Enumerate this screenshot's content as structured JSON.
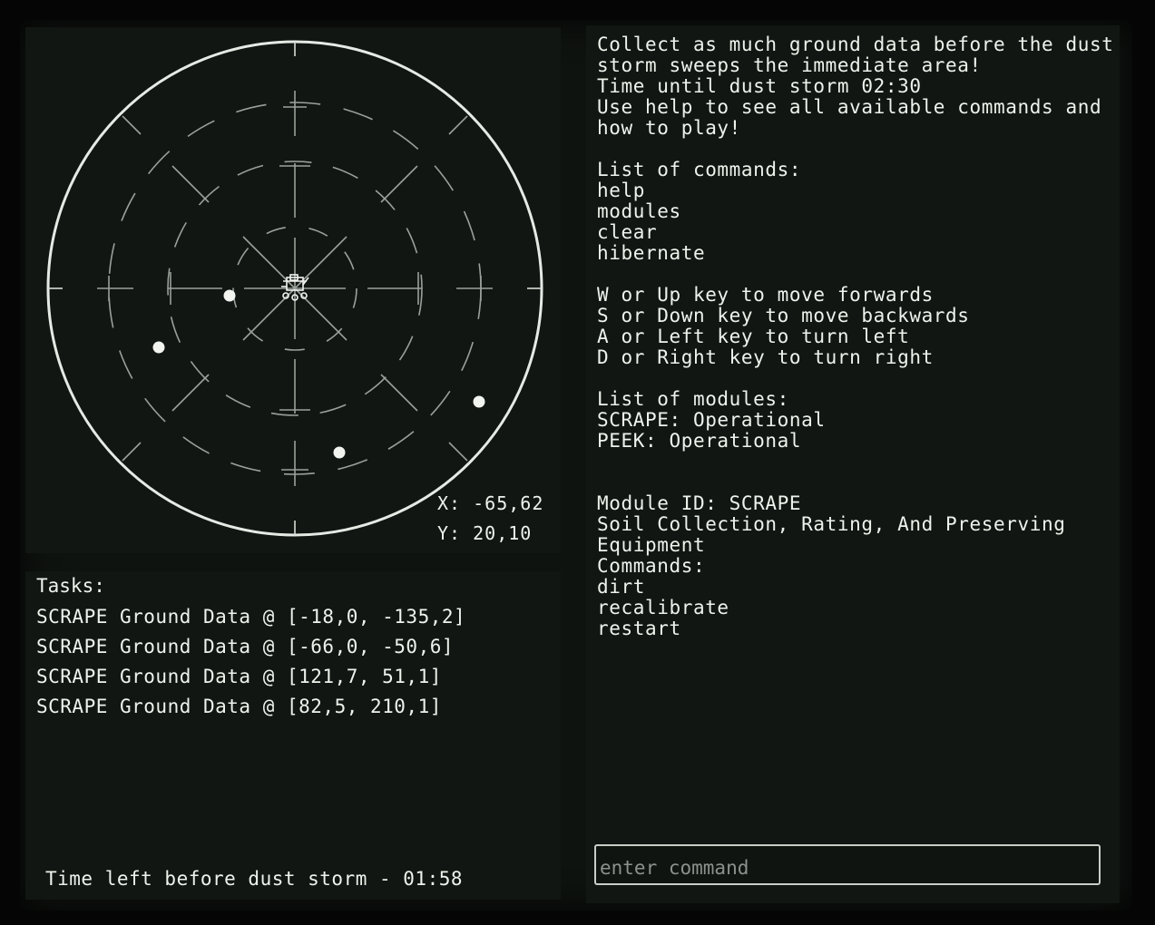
{
  "radar": {
    "coord_x": "X: -65,62",
    "coord_y": "Y: 20,10",
    "targets": [
      {
        "id": "target-1"
      },
      {
        "id": "target-2"
      },
      {
        "id": "target-3"
      },
      {
        "id": "target-4"
      }
    ]
  },
  "tasks": {
    "title": "Tasks:",
    "items": [
      "SCRAPE Ground Data @ [-18,0, -135,2]",
      "SCRAPE Ground Data @ [-66,0, -50,6]",
      "SCRAPE Ground Data @ [121,7, 51,1]",
      "SCRAPE Ground Data @ [82,5, 210,1]"
    ],
    "timer": "Time left before dust storm - 01:58"
  },
  "console": {
    "lines": [
      "Collect as much ground data before the dust",
      "storm sweeps the immediate area!",
      "Time until dust storm 02:30",
      "Use help to see all available commands and",
      "how to play!",
      "",
      "List of commands:",
      "help",
      "modules",
      "clear",
      "hibernate",
      "",
      "W or Up key to move forwards",
      "S or Down key to move backwards",
      "A or Left key to turn left",
      "D or Right key to turn right",
      "",
      "List of modules:",
      "SCRAPE: Operational",
      "PEEK: Operational",
      "",
      "",
      "Module ID: SCRAPE",
      "Soil Collection, Rating, And Preserving",
      "Equipment",
      "Commands:",
      "dirt",
      "recalibrate",
      "restart"
    ],
    "input_placeholder": "enter command",
    "input_value": ""
  },
  "colors": {
    "background": "#0f1310",
    "panel": "#111612",
    "text": "#eef2ec",
    "radar_lines": "#9aa09a",
    "radar_ring": "#e6eae5"
  }
}
